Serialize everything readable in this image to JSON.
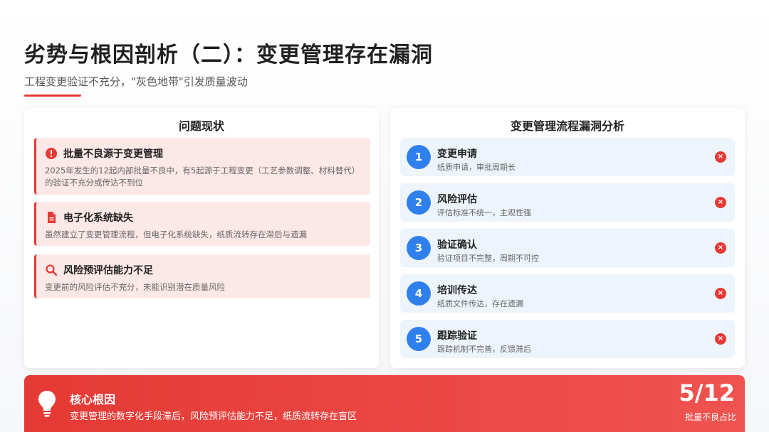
{
  "header": {
    "title": "劣势与根因剖析（二）：变更管理存在漏洞",
    "subtitle": "工程变更验证不充分，\"灰色地带\"引发质量波动"
  },
  "left_panel": {
    "title": "问题现状",
    "issues": [
      {
        "icon": "alert-circle-icon",
        "title": "批量不良源于变更管理",
        "desc": "2025年发生的12起内部批量不良中，有5起源于工程变更（工艺参数调整、材料替代）的验证不充分或传达不到位"
      },
      {
        "icon": "document-icon",
        "title": "电子化系统缺失",
        "desc": "虽然建立了变更管理流程，但电子化系统缺失，纸质流转存在滞后与遗漏"
      },
      {
        "icon": "search-icon",
        "title": "风险预评估能力不足",
        "desc": "变更前的风险评估不充分，未能识别潜在质量风险"
      }
    ]
  },
  "right_panel": {
    "title": "变更管理流程漏洞分析",
    "steps": [
      {
        "num": "1",
        "title": "变更申请",
        "desc": "纸质申请，审批周期长",
        "mark": "×"
      },
      {
        "num": "2",
        "title": "风险评估",
        "desc": "评估标准不统一，主观性强",
        "mark": "×"
      },
      {
        "num": "3",
        "title": "验证确认",
        "desc": "验证项目不完整，周期不可控",
        "mark": "×"
      },
      {
        "num": "4",
        "title": "培训传达",
        "desc": "纸质文件传达，存在遗漏",
        "mark": "×"
      },
      {
        "num": "5",
        "title": "跟踪验证",
        "desc": "跟踪机制不完善，反馈滞后",
        "mark": "×"
      }
    ]
  },
  "banner": {
    "icon": "lightbulb-icon",
    "title": "核心根因",
    "desc": "变更管理的数字化手段滞后，风险预评估能力不足，纸质流转存在盲区",
    "stat": "5/12",
    "stat_label": "批量不良占比"
  },
  "colors": {
    "accent_red": "#e53935",
    "issue_bg": "#fde8e8",
    "step_bg": "#eef4fc",
    "step_num": "#2f80ed"
  }
}
